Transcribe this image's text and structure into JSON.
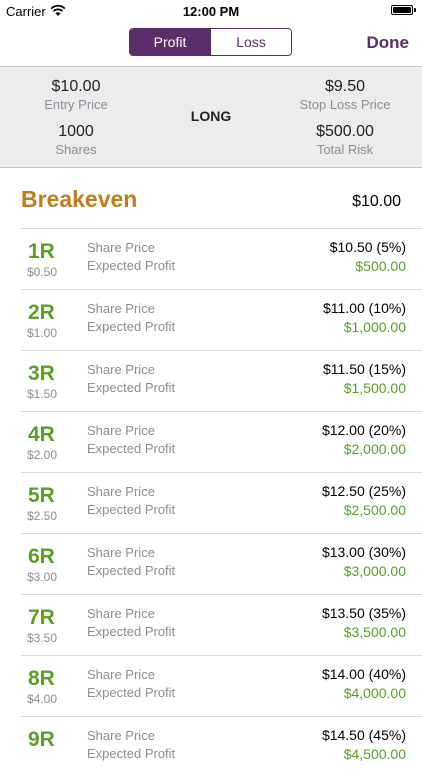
{
  "status_bar": {
    "carrier": "Carrier",
    "time": "12:00 PM",
    "battery_level": 1.0
  },
  "nav": {
    "segments": [
      "Profit",
      "Loss"
    ],
    "selected": "Profit",
    "done_label": "Done"
  },
  "colors": {
    "accent": "#5c2d6b",
    "profit_green": "#5aa024",
    "breakeven_gold": "#c07d1e"
  },
  "summary": {
    "entry_price": {
      "value": "$10.00",
      "label": "Entry Price"
    },
    "shares": {
      "value": "1000",
      "label": "Shares"
    },
    "direction": "LONG",
    "stop_loss": {
      "value": "$9.50",
      "label": "Stop Loss Price"
    },
    "total_risk": {
      "value": "$500.00",
      "label": "Total Risk"
    }
  },
  "breakeven": {
    "label": "Breakeven",
    "value": "$10.00"
  },
  "row_labels": {
    "share_price": "Share Price",
    "expected_profit": "Expected Profit"
  },
  "rows": [
    {
      "r": "1R",
      "amount": "$0.50",
      "price": "$10.50 (5%)",
      "profit": "$500.00"
    },
    {
      "r": "2R",
      "amount": "$1.00",
      "price": "$11.00 (10%)",
      "profit": "$1,000.00"
    },
    {
      "r": "3R",
      "amount": "$1.50",
      "price": "$11.50 (15%)",
      "profit": "$1,500.00"
    },
    {
      "r": "4R",
      "amount": "$2.00",
      "price": "$12.00 (20%)",
      "profit": "$2,000.00"
    },
    {
      "r": "5R",
      "amount": "$2.50",
      "price": "$12.50 (25%)",
      "profit": "$2,500.00"
    },
    {
      "r": "6R",
      "amount": "$3.00",
      "price": "$13.00 (30%)",
      "profit": "$3,000.00"
    },
    {
      "r": "7R",
      "amount": "$3.50",
      "price": "$13.50 (35%)",
      "profit": "$3,500.00"
    },
    {
      "r": "8R",
      "amount": "$4.00",
      "price": "$14.00 (40%)",
      "profit": "$4,000.00"
    },
    {
      "r": "9R",
      "amount": "",
      "price": "$14.50 (45%)",
      "profit": "$4,500.00"
    }
  ]
}
